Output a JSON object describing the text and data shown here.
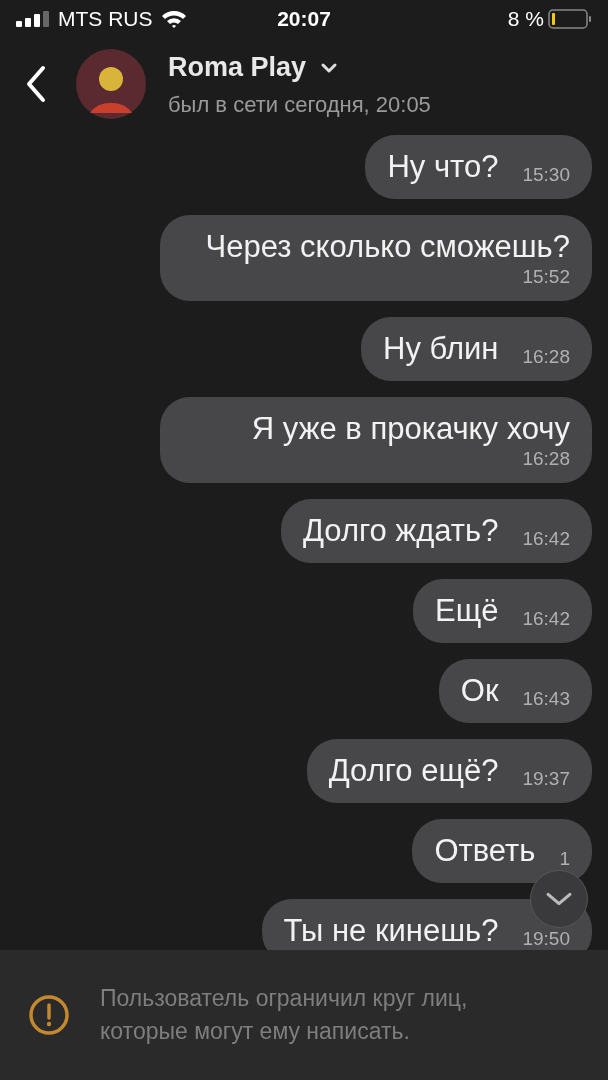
{
  "status_bar": {
    "carrier": "MTS RUS",
    "time": "20:07",
    "battery": "8 %"
  },
  "header": {
    "name": "Roma Play",
    "last_seen": "был в сети сегодня, 20:05"
  },
  "messages": [
    {
      "text": "Ну что?",
      "time": "15:30"
    },
    {
      "text": "Через сколько сможешь?",
      "time": "15:52"
    },
    {
      "text": "Ну блин",
      "time": "16:28"
    },
    {
      "text": "Я уже в прокачку хочу",
      "time": "16:28"
    },
    {
      "text": "Долго ждать?",
      "time": "16:42"
    },
    {
      "text": "Ещё",
      "time": "16:42"
    },
    {
      "text": "Ок",
      "time": "16:43"
    },
    {
      "text": "Долго ещё?",
      "time": "19:37"
    },
    {
      "text": "Ответь",
      "time": "1"
    },
    {
      "text": "Ты не кинешь?",
      "time": "19:50"
    }
  ],
  "notice": {
    "text": "Пользователь ограничил круг лиц, которые могут ему написать."
  }
}
